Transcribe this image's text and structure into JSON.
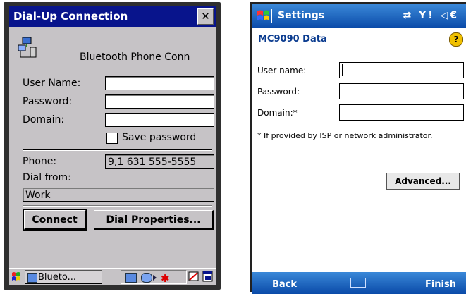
{
  "ce_dialog": {
    "title": "Dial-Up Connection",
    "close_glyph": "✕",
    "connection_name": "Bluetooth Phone Conn",
    "user_name_label": "User Name:",
    "password_label": "Password:",
    "domain_label": "Domain:",
    "user_name_value": "",
    "password_value": "",
    "domain_value": "",
    "save_password_label": "Save password",
    "save_password_checked": false,
    "phone_label": "Phone:",
    "phone_value": "9,1 631 555-5555",
    "dial_from_label": "Dial from:",
    "dial_from_value": "Work",
    "connect_button": "Connect",
    "dial_properties_button": "Dial Properties...",
    "icons": [
      "network-connection-icon",
      "start-menu-icon",
      "bluetooth-icon",
      "desktop-icon",
      "switch-window-icon"
    ]
  },
  "ce_taskbar": {
    "app_label": "Blueto..."
  },
  "wm_settings": {
    "title": "Settings",
    "status_icons": "⇄ Y! ◁€",
    "subtitle": "MC9090 Data",
    "help_glyph": "?",
    "user_name_label": "User name:",
    "password_label": "Password:",
    "domain_label": "Domain:*",
    "note": "* If provided by ISP or network administrator.",
    "advanced_button": "Advanced...",
    "back_softkey": "Back",
    "finish_softkey": "Finish",
    "colors": {
      "titlebar": "#0a4aa8",
      "ce_titlebar": "#08148c",
      "ce_face": "#c6c3c6"
    }
  }
}
